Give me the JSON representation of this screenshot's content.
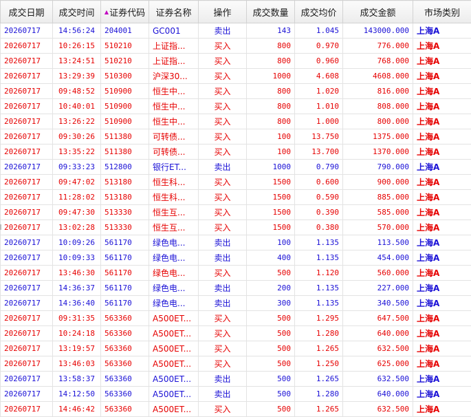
{
  "columns": {
    "date": "成交日期",
    "time": "成交时间",
    "code": "证券代码",
    "name": "证券名称",
    "op": "操作",
    "qty": "成交数量",
    "avg": "成交均价",
    "amount": "成交金额",
    "market": "市场类别"
  },
  "sort": {
    "column": "code",
    "icon": "sort-ascending-triangle-icon",
    "color": "#c100c1"
  },
  "colors": {
    "buy": "#e60000",
    "sell": "#1a10d6"
  },
  "rows": [
    {
      "date": "20260717",
      "time": "14:56:24",
      "code": "204001",
      "name": "GC001",
      "op": "卖出",
      "qty": "143",
      "avg": "1.045",
      "amount": "143000.000",
      "market": "上海A",
      "side": "sell"
    },
    {
      "date": "20260717",
      "time": "10:26:15",
      "code": "510210",
      "name": "上证指...",
      "op": "买入",
      "qty": "800",
      "avg": "0.970",
      "amount": "776.000",
      "market": "上海A",
      "side": "buy"
    },
    {
      "date": "20260717",
      "time": "13:24:51",
      "code": "510210",
      "name": "上证指...",
      "op": "买入",
      "qty": "800",
      "avg": "0.960",
      "amount": "768.000",
      "market": "上海A",
      "side": "buy"
    },
    {
      "date": "20260717",
      "time": "13:29:39",
      "code": "510300",
      "name": "沪深30...",
      "op": "买入",
      "qty": "1000",
      "avg": "4.608",
      "amount": "4608.000",
      "market": "上海A",
      "side": "buy"
    },
    {
      "date": "20260717",
      "time": "09:48:52",
      "code": "510900",
      "name": "恒生中...",
      "op": "买入",
      "qty": "800",
      "avg": "1.020",
      "amount": "816.000",
      "market": "上海A",
      "side": "buy"
    },
    {
      "date": "20260717",
      "time": "10:40:01",
      "code": "510900",
      "name": "恒生中...",
      "op": "买入",
      "qty": "800",
      "avg": "1.010",
      "amount": "808.000",
      "market": "上海A",
      "side": "buy"
    },
    {
      "date": "20260717",
      "time": "13:26:22",
      "code": "510900",
      "name": "恒生中...",
      "op": "买入",
      "qty": "800",
      "avg": "1.000",
      "amount": "800.000",
      "market": "上海A",
      "side": "buy"
    },
    {
      "date": "20260717",
      "time": "09:30:26",
      "code": "511380",
      "name": "可转债...",
      "op": "买入",
      "qty": "100",
      "avg": "13.750",
      "amount": "1375.000",
      "market": "上海A",
      "side": "buy"
    },
    {
      "date": "20260717",
      "time": "13:35:22",
      "code": "511380",
      "name": "可转债...",
      "op": "买入",
      "qty": "100",
      "avg": "13.700",
      "amount": "1370.000",
      "market": "上海A",
      "side": "buy"
    },
    {
      "date": "20260717",
      "time": "09:33:23",
      "code": "512800",
      "name": "银行ET...",
      "op": "卖出",
      "qty": "1000",
      "avg": "0.790",
      "amount": "790.000",
      "market": "上海A",
      "side": "sell"
    },
    {
      "date": "20260717",
      "time": "09:47:02",
      "code": "513180",
      "name": "恒生科...",
      "op": "买入",
      "qty": "1500",
      "avg": "0.600",
      "amount": "900.000",
      "market": "上海A",
      "side": "buy"
    },
    {
      "date": "20260717",
      "time": "11:28:02",
      "code": "513180",
      "name": "恒生科...",
      "op": "买入",
      "qty": "1500",
      "avg": "0.590",
      "amount": "885.000",
      "market": "上海A",
      "side": "buy"
    },
    {
      "date": "20260717",
      "time": "09:47:30",
      "code": "513330",
      "name": "恒生互...",
      "op": "买入",
      "qty": "1500",
      "avg": "0.390",
      "amount": "585.000",
      "market": "上海A",
      "side": "buy"
    },
    {
      "date": "20260717",
      "time": "13:02:28",
      "code": "513330",
      "name": "恒生互...",
      "op": "买入",
      "qty": "1500",
      "avg": "0.380",
      "amount": "570.000",
      "market": "上海A",
      "side": "buy"
    },
    {
      "date": "20260717",
      "time": "10:09:26",
      "code": "561170",
      "name": "绿色电...",
      "op": "卖出",
      "qty": "100",
      "avg": "1.135",
      "amount": "113.500",
      "market": "上海A",
      "side": "sell"
    },
    {
      "date": "20260717",
      "time": "10:09:33",
      "code": "561170",
      "name": "绿色电...",
      "op": "卖出",
      "qty": "400",
      "avg": "1.135",
      "amount": "454.000",
      "market": "上海A",
      "side": "sell"
    },
    {
      "date": "20260717",
      "time": "13:46:30",
      "code": "561170",
      "name": "绿色电...",
      "op": "买入",
      "qty": "500",
      "avg": "1.120",
      "amount": "560.000",
      "market": "上海A",
      "side": "buy"
    },
    {
      "date": "20260717",
      "time": "14:36:37",
      "code": "561170",
      "name": "绿色电...",
      "op": "卖出",
      "qty": "200",
      "avg": "1.135",
      "amount": "227.000",
      "market": "上海A",
      "side": "sell"
    },
    {
      "date": "20260717",
      "time": "14:36:40",
      "code": "561170",
      "name": "绿色电...",
      "op": "卖出",
      "qty": "300",
      "avg": "1.135",
      "amount": "340.500",
      "market": "上海A",
      "side": "sell"
    },
    {
      "date": "20260717",
      "time": "09:31:35",
      "code": "563360",
      "name": "A500ET...",
      "op": "买入",
      "qty": "500",
      "avg": "1.295",
      "amount": "647.500",
      "market": "上海A",
      "side": "buy"
    },
    {
      "date": "20260717",
      "time": "10:24:18",
      "code": "563360",
      "name": "A500ET...",
      "op": "买入",
      "qty": "500",
      "avg": "1.280",
      "amount": "640.000",
      "market": "上海A",
      "side": "buy"
    },
    {
      "date": "20260717",
      "time": "13:19:57",
      "code": "563360",
      "name": "A500ET...",
      "op": "买入",
      "qty": "500",
      "avg": "1.265",
      "amount": "632.500",
      "market": "上海A",
      "side": "buy"
    },
    {
      "date": "20260717",
      "time": "13:46:03",
      "code": "563360",
      "name": "A500ET...",
      "op": "买入",
      "qty": "500",
      "avg": "1.250",
      "amount": "625.000",
      "market": "上海A",
      "side": "buy"
    },
    {
      "date": "20260717",
      "time": "13:58:37",
      "code": "563360",
      "name": "A500ET...",
      "op": "卖出",
      "qty": "500",
      "avg": "1.265",
      "amount": "632.500",
      "market": "上海A",
      "side": "sell"
    },
    {
      "date": "20260717",
      "time": "14:12:50",
      "code": "563360",
      "name": "A500ET...",
      "op": "卖出",
      "qty": "500",
      "avg": "1.280",
      "amount": "640.000",
      "market": "上海A",
      "side": "sell"
    },
    {
      "date": "20260717",
      "time": "14:46:42",
      "code": "563360",
      "name": "A500ET...",
      "op": "买入",
      "qty": "500",
      "avg": "1.265",
      "amount": "632.500",
      "market": "上海A",
      "side": "buy"
    }
  ]
}
